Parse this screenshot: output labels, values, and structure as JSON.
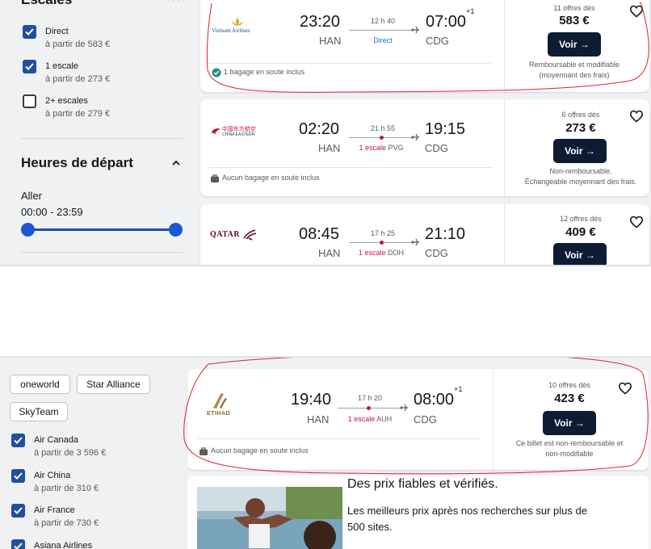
{
  "sidebar": {
    "stops_title": "Escales",
    "stops": [
      {
        "label": "Direct",
        "from": "à partir de 583 €",
        "checked": true
      },
      {
        "label": "1 escale",
        "from": "à partir de 273 €",
        "checked": true
      },
      {
        "label": "2+ escales",
        "from": "à partir de 279 €",
        "checked": false
      }
    ],
    "departure_title": "Heures de départ",
    "outbound_label": "Aller",
    "outbound_range": "00:00 - 23:59",
    "alliances": [
      "oneworld",
      "Star Alliance",
      "SkyTeam"
    ],
    "airlines": [
      {
        "label": "Air Canada",
        "from": "à partir de 3 596 €",
        "checked": true
      },
      {
        "label": "Air China",
        "from": "à partir de 310 €",
        "checked": true
      },
      {
        "label": "Air France",
        "from": "à partir de 730 €",
        "checked": true
      },
      {
        "label": "Asiana Airlines",
        "from": "",
        "checked": true
      }
    ]
  },
  "flights": [
    {
      "airline": "Vietnam Airlines",
      "dep_time": "23:20",
      "dep_code": "HAN",
      "duration": "12 h 40",
      "stops_text": "Direct",
      "stop_airport": "",
      "arr_time": "07:00",
      "arr_offset": "+1",
      "arr_code": "CDG",
      "baggage": "1 bagage en soute inclus",
      "offers": "11 offres dès",
      "price": "583 €",
      "button": "Voir →",
      "note": [
        "Remboursable et modifiable",
        "(moyennant des frais)"
      ]
    },
    {
      "airline": "China Eastern",
      "dep_time": "02:20",
      "dep_code": "HAN",
      "duration": "21 h 55",
      "stops_text": "1 escale",
      "stop_airport": "PVG",
      "arr_time": "19:15",
      "arr_offset": "",
      "arr_code": "CDG",
      "baggage": "Aucun bagage en soute inclus",
      "offers": "6 offres dès",
      "price": "273 €",
      "button": "Voir →",
      "note": [
        "Non-remboursable.",
        "Échangeable moyennant des frais."
      ]
    },
    {
      "airline": "Qatar Airways",
      "dep_time": "08:45",
      "dep_code": "HAN",
      "duration": "17 h 25",
      "stops_text": "1 escale",
      "stop_airport": "DOH",
      "arr_time": "21:10",
      "arr_offset": "",
      "arr_code": "CDG",
      "baggage": "",
      "offers": "12 offres dès",
      "price": "409 €",
      "button": "Voir →",
      "note": []
    },
    {
      "airline": "Etihad",
      "dep_time": "19:40",
      "dep_code": "HAN",
      "duration": "17 h 20",
      "stops_text": "1 escale",
      "stop_airport": "AUH",
      "arr_time": "08:00",
      "arr_offset": "+1",
      "arr_code": "CDG",
      "baggage": "Aucun bagage en soute inclus",
      "offers": "10 offres dès",
      "price": "423 €",
      "button": "Voir →",
      "note": [
        "Ce billet est non-remboursable et",
        "non-modifiable"
      ]
    }
  ],
  "logos": {
    "vietnam": "Vietnam Airlines",
    "china_main": "中国东方航空",
    "china_sub": "CHINA EASTERN",
    "qatar": "QATAR",
    "etihad": "ETIHAD"
  },
  "promo": {
    "title": "Des prix fiables et vérifiés.",
    "text": "Les meilleurs prix après nos recherches sur plus de 500 sites."
  },
  "colors": {
    "accent": "#1f4fa3",
    "button": "#0e1c33",
    "stop_red": "#c0135a",
    "annotation": "#d9232d"
  }
}
